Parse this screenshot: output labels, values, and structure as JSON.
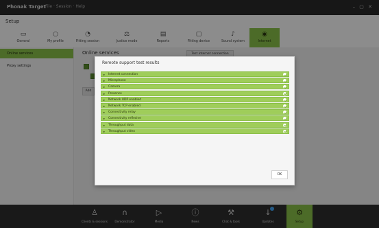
{
  "window": {
    "title": "Phonak Target",
    "subtitle": "File · Session · Help",
    "controls": "– ▢ ✕"
  },
  "page": {
    "section": "Setup"
  },
  "nav": {
    "items": [
      {
        "label": "General",
        "icon": "monitor-icon"
      },
      {
        "label": "My profile",
        "icon": "user-icon"
      },
      {
        "label": "Fitting session",
        "icon": "fitting-icon"
      },
      {
        "label": "Justice mode",
        "icon": "balance-icon"
      },
      {
        "label": "Reports",
        "icon": "document-icon"
      },
      {
        "label": "Fitting device",
        "icon": "device-icon"
      },
      {
        "label": "Sound system",
        "icon": "music-icon"
      },
      {
        "label": "Internet",
        "icon": "globe-icon",
        "active": true
      }
    ]
  },
  "sidebar": {
    "items": [
      {
        "label": "Online services",
        "active": true
      },
      {
        "label": "Proxy settings"
      }
    ]
  },
  "main": {
    "heading": "Online services",
    "test_button": "Test internet connection",
    "add_button": "Add"
  },
  "dialog": {
    "title": "Remote support test results",
    "results": [
      "Internet connection",
      "Microphone",
      "Camera",
      "Presence",
      "Network UDP enabled",
      "Network TCP enabled",
      "Connectivity relay",
      "Connectivity reflexive",
      "Throughput data",
      "Throughput video"
    ],
    "ok_label": "OK"
  },
  "bottom_nav": {
    "items": [
      {
        "label": "Clients & sessions",
        "icon": "person-icon"
      },
      {
        "label": "Demonstrator",
        "icon": "headphones-icon"
      },
      {
        "label": "Media",
        "icon": "play-icon"
      },
      {
        "label": "News",
        "icon": "info-icon"
      },
      {
        "label": "Chat & tools",
        "icon": "wrench-icon"
      },
      {
        "label": "Updates",
        "icon": "download-icon",
        "badge": true
      },
      {
        "label": "Setup",
        "icon": "gear-icon",
        "active": true
      }
    ]
  },
  "colors": {
    "accent": "#8bc34a",
    "result_row": "#9fcd5a",
    "titlebar": "#2b2b2b",
    "bottombar": "#2f2f2f"
  }
}
